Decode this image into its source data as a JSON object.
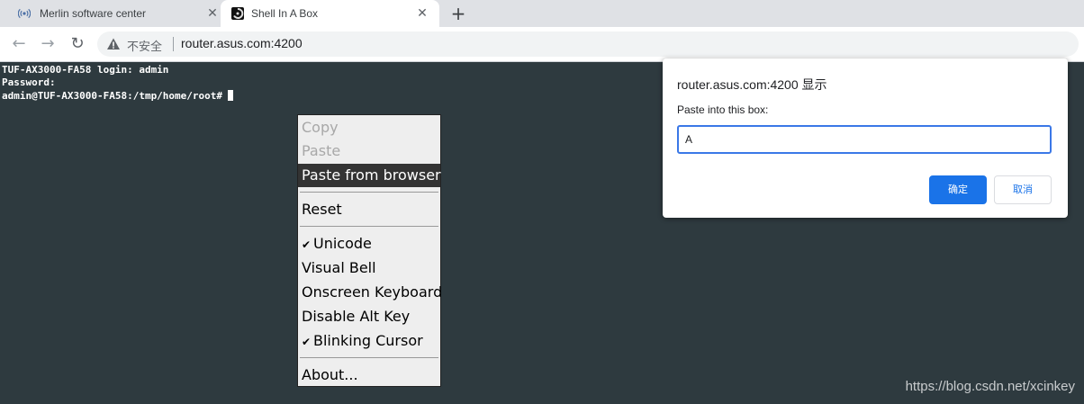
{
  "tabs": [
    {
      "title": "Merlin software center",
      "icon": "wifi-broadcast-icon"
    },
    {
      "title": "Shell In A Box",
      "icon": "shellinabox-icon",
      "active": true
    }
  ],
  "omnibox": {
    "security_label": "不安全",
    "url": "router.asus.com:4200"
  },
  "terminal": {
    "lines": [
      "TUF-AX3000-FA58 login: admin",
      "Password:",
      "admin@TUF-AX3000-FA58:/tmp/home/root#"
    ]
  },
  "context_menu": {
    "items": [
      {
        "label": "Copy",
        "enabled": false
      },
      {
        "label": "Paste",
        "enabled": false
      },
      {
        "label": "Paste from browser",
        "highlighted": true
      },
      {
        "label": "Reset"
      },
      {
        "label": "Unicode",
        "checked": true
      },
      {
        "label": "Visual Bell"
      },
      {
        "label": "Onscreen Keyboard"
      },
      {
        "label": "Disable Alt Key"
      },
      {
        "label": "Blinking Cursor",
        "checked": true
      },
      {
        "label": "About..."
      }
    ],
    "checkmark": "✔"
  },
  "dialog": {
    "title": "router.asus.com:4200 显示",
    "message": "Paste into this box:",
    "input_value": "A",
    "ok_label": "确定",
    "cancel_label": "取消"
  },
  "watermark": "https://blog.csdn.net/xcinkey",
  "colors": {
    "terminal_bg": "#2e3a3f",
    "accent": "#1a73e8",
    "menu_highlight": "#333333"
  }
}
